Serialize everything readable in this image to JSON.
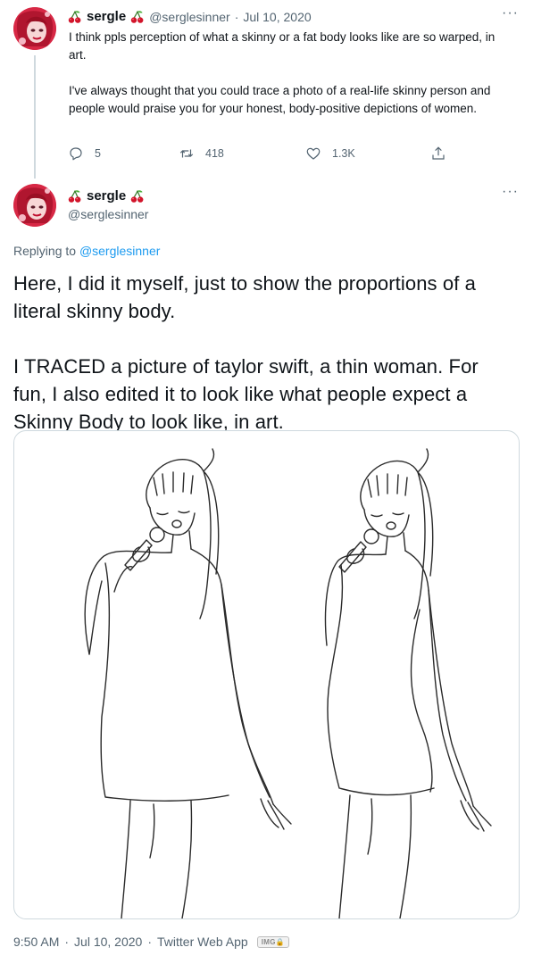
{
  "tweet1": {
    "display_name": "sergle",
    "handle": "@serglesinner",
    "separator": "·",
    "date": "Jul 10, 2020",
    "more": "···",
    "text_p1": "I think ppls perception of what a skinny or a fat body looks like are so warped, in art.",
    "text_p2": "I've always thought that you could trace a photo of a real-life skinny person and people would praise you for your honest, body-positive depictions of women.",
    "actions": {
      "reply_count": "5",
      "retweet_count": "418",
      "like_count": "1.3K"
    }
  },
  "tweet2": {
    "display_name": "sergle",
    "handle": "@serglesinner",
    "more": "···",
    "replying_prefix": "Replying to",
    "replying_handle": "@serglesinner",
    "text_p1": "Here, I did it myself, just to show the proportions of a literal skinny body.",
    "text_p2": "I TRACED a picture of taylor swift, a thin woman. For fun, I also edited it to look like what people expect a Skinny Body to look like, in art.",
    "footer_time": "9:50 AM",
    "footer_sep1": "·",
    "footer_date": "Jul 10, 2020",
    "footer_sep2": "·",
    "footer_source": "Twitter Web App",
    "footer_badge": "IMG🔒"
  },
  "icons": {
    "cherry": "cherry-icon",
    "reply": "reply-icon",
    "retweet": "retweet-icon",
    "like": "heart-icon",
    "share": "share-icon"
  },
  "colors": {
    "link": "#1d9bf0",
    "muted": "#536471",
    "text": "#0f1419",
    "border": "#cfd9de",
    "avatar_red": "#c8102e"
  }
}
